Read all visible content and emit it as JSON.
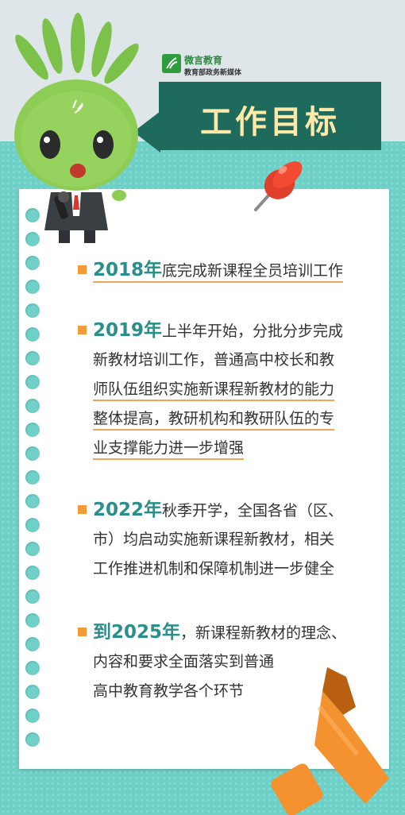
{
  "colors": {
    "teal_bg": "#6fd0c8",
    "banner": "#1e6b5d",
    "banner_text": "#ffe9a8",
    "year_text": "#2a8f8a",
    "bullet": "#f39a3a",
    "underline": "#f3a45a",
    "marker": "#f3922e"
  },
  "logo": {
    "name": "微言教育",
    "subtitle": "教育部政务新媒体"
  },
  "banner": {
    "title": "工作目标"
  },
  "items": [
    {
      "year": "2018年",
      "lines": [
        "底完成新课程全员培训工作"
      ]
    },
    {
      "year": "2019年",
      "lines": [
        "上半年开始，分批分步完成",
        "新教材培训工作，普通高中校长和教",
        "师队伍组织实施新课程新教材的能力",
        "整体提高，教研机构和教研队伍的专",
        "业支撑能力进一步增强"
      ]
    },
    {
      "year": "2022年",
      "lines": [
        "秋季开学，全国各省（区、",
        "市）均启动实施新课程新教材，相关",
        "工作推进机制和保障机制进一步健全"
      ]
    },
    {
      "year": "到2025年",
      "lines": [
        "，新课程新教材的理念、",
        "内容和要求全面落实到普通",
        "高中教育教学各个环节"
      ]
    }
  ],
  "icons": [
    "mascot-icon",
    "logo-icon",
    "pushpin-icon",
    "highlighter-icon"
  ]
}
